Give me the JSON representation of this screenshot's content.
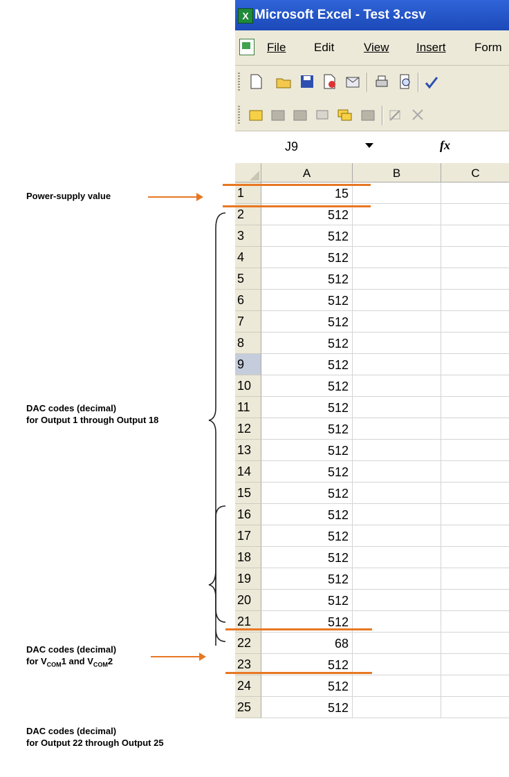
{
  "window": {
    "title": "Microsoft Excel - Test 3.csv",
    "app_icon": "excel-icon"
  },
  "menu": {
    "items": [
      "File",
      "Edit",
      "View",
      "Insert",
      "Form"
    ]
  },
  "formula_bar": {
    "name_box": "J9",
    "fx_label": "fx",
    "formula": ""
  },
  "sheet": {
    "columns": [
      "A",
      "B",
      "C"
    ],
    "selected_row": 9,
    "rows": [
      {
        "n": "1",
        "a": "15"
      },
      {
        "n": "2",
        "a": "512"
      },
      {
        "n": "3",
        "a": "512"
      },
      {
        "n": "4",
        "a": "512"
      },
      {
        "n": "5",
        "a": "512"
      },
      {
        "n": "6",
        "a": "512"
      },
      {
        "n": "7",
        "a": "512"
      },
      {
        "n": "8",
        "a": "512"
      },
      {
        "n": "9",
        "a": "512"
      },
      {
        "n": "10",
        "a": "512"
      },
      {
        "n": "11",
        "a": "512"
      },
      {
        "n": "12",
        "a": "512"
      },
      {
        "n": "13",
        "a": "512"
      },
      {
        "n": "14",
        "a": "512"
      },
      {
        "n": "15",
        "a": "512"
      },
      {
        "n": "16",
        "a": "512"
      },
      {
        "n": "17",
        "a": "512"
      },
      {
        "n": "18",
        "a": "512"
      },
      {
        "n": "19",
        "a": "512"
      },
      {
        "n": "20",
        "a": "512"
      },
      {
        "n": "21",
        "a": "512"
      },
      {
        "n": "22",
        "a": "68"
      },
      {
        "n": "23",
        "a": "512"
      },
      {
        "n": "24",
        "a": "512"
      },
      {
        "n": "25",
        "a": "512"
      }
    ]
  },
  "annotations": {
    "power_supply": "Power-supply value",
    "dac_outputs_1_18_line1": "DAC codes (decimal)",
    "dac_outputs_1_18_line2": "for Output 1 through Output 18",
    "dac_vcom_line1": "DAC codes (decimal)",
    "dac_vcom_line2_a": "for V",
    "dac_vcom_sub": "COM",
    "dac_vcom_line2_b": "1 and V",
    "dac_vcom_line2_c": "2",
    "dac_outputs_22_25_line1": "DAC codes (decimal)",
    "dac_outputs_22_25_line2": "for Output 22 through Output 25"
  },
  "colors": {
    "accent_orange": "#e87722",
    "titlebar_blue": "#2f64d8",
    "chrome": "#ece9d8"
  }
}
